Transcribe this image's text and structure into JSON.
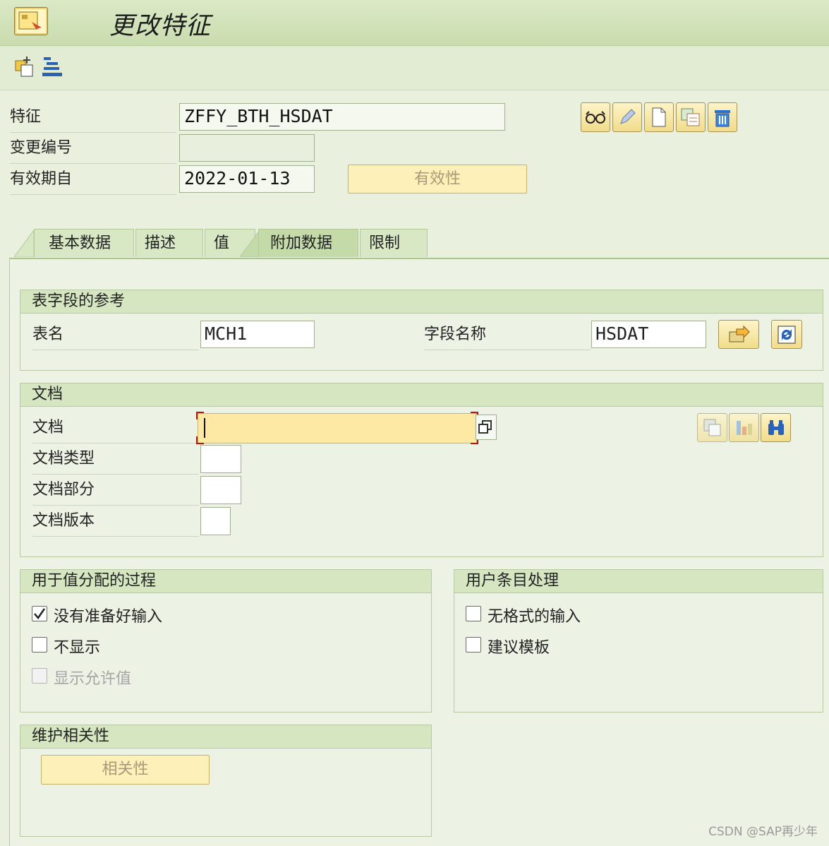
{
  "window": {
    "title": "更改特征"
  },
  "header": {
    "characteristic_label": "特征",
    "characteristic_value": "ZFFY_BTH_HSDAT",
    "change_number_label": "变更编号",
    "change_number_value": "",
    "valid_from_label": "有效期自",
    "valid_from_value": "2022-01-13",
    "validity_button": "有效性"
  },
  "tabs": [
    {
      "label": "基本数据"
    },
    {
      "label": "描述"
    },
    {
      "label": "值"
    },
    {
      "label": "附加数据"
    },
    {
      "label": "限制"
    }
  ],
  "active_tab": "附加数据",
  "table_ref": {
    "title": "表字段的参考",
    "table_label": "表名",
    "table_value": "MCH1",
    "field_label": "字段名称",
    "field_value": "HSDAT"
  },
  "document": {
    "title": "文档",
    "doc_label": "文档",
    "doc_value": "",
    "type_label": "文档类型",
    "part_label": "文档部分",
    "version_label": "文档版本"
  },
  "value_assignment": {
    "title": "用于值分配的过程",
    "options": [
      {
        "label": "没有准备好输入",
        "checked": true,
        "disabled": false
      },
      {
        "label": "不显示",
        "checked": false,
        "disabled": false
      },
      {
        "label": "显示允许值",
        "checked": false,
        "disabled": true
      }
    ]
  },
  "user_entry": {
    "title": "用户条目处理",
    "options": [
      {
        "label": "无格式的输入",
        "checked": false
      },
      {
        "label": "建议模板",
        "checked": false
      }
    ]
  },
  "dependencies": {
    "title": "维护相关性",
    "button": "相关性"
  },
  "watermark": "CSDN @SAP再少年",
  "colors": {
    "background": "#e9f1de",
    "button_yellow": "#fdf0b8",
    "doc_field": "#fde9a3",
    "active_tab": "#c4daa8"
  }
}
